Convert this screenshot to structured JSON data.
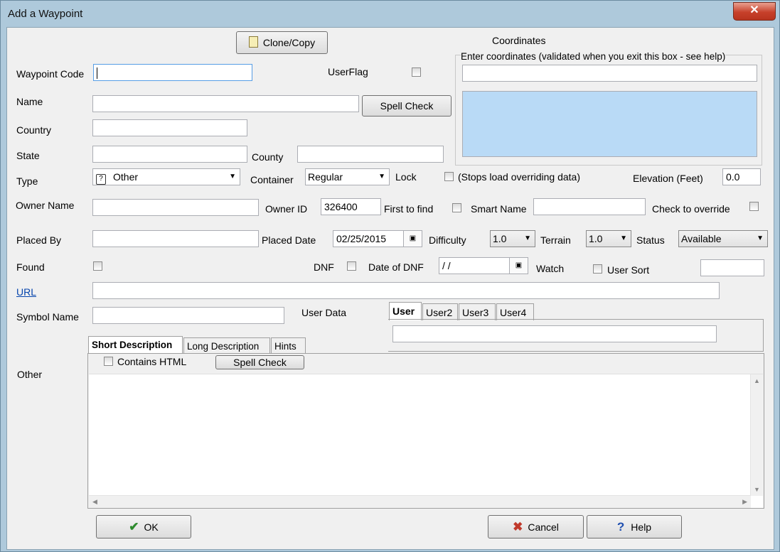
{
  "window": {
    "title": "Add a Waypoint",
    "close_label": "✕"
  },
  "toolbar": {
    "clone_label": "Clone/Copy"
  },
  "coordinates": {
    "title": "Coordinates",
    "group_label": "Enter coordinates (validated when you exit this box - see help)",
    "input_value": "",
    "result_value": ""
  },
  "fields": {
    "waypoint_code": {
      "label": "Waypoint Code",
      "value": ""
    },
    "user_flag": {
      "label": "UserFlag",
      "checked": false
    },
    "name": {
      "label": "Name",
      "value": ""
    },
    "spell_check_label": "Spell Check",
    "country": {
      "label": "Country",
      "value": ""
    },
    "state": {
      "label": "State",
      "value": ""
    },
    "county": {
      "label": "County",
      "value": ""
    },
    "type": {
      "label": "Type",
      "value": "Other"
    },
    "container": {
      "label": "Container",
      "value": "Regular"
    },
    "lock": {
      "label": "Lock",
      "note": "(Stops load overriding data)"
    },
    "elevation": {
      "label": "Elevation (Feet)",
      "value": "0.0"
    },
    "owner_name": {
      "label": "Owner Name",
      "value": ""
    },
    "owner_id": {
      "label": "Owner ID",
      "value": "326400"
    },
    "first_to_find": {
      "label": "First to find"
    },
    "smart_name": {
      "label": "Smart Name",
      "value": ""
    },
    "check_to_override": {
      "label": "Check to override"
    },
    "placed_by": {
      "label": "Placed By",
      "value": ""
    },
    "placed_date": {
      "label": "Placed Date",
      "value": "02/25/2015"
    },
    "difficulty": {
      "label": "Difficulty",
      "value": "1.0"
    },
    "terrain": {
      "label": "Terrain",
      "value": "1.0"
    },
    "status": {
      "label": "Status",
      "value": "Available"
    },
    "found": {
      "label": "Found"
    },
    "dnf": {
      "label": "DNF"
    },
    "date_of_dnf": {
      "label": "Date of DNF",
      "value": " / /"
    },
    "watch": {
      "label": "Watch"
    },
    "user_sort": {
      "label": "User Sort",
      "value": ""
    },
    "url": {
      "label": "URL",
      "value": ""
    },
    "symbol_name": {
      "label": "Symbol Name",
      "value": ""
    },
    "user_data": {
      "label": "User Data"
    },
    "other": {
      "label": "Other"
    }
  },
  "user_tabs": {
    "tabs": [
      {
        "label": "User"
      },
      {
        "label": "User2"
      },
      {
        "label": "User3"
      },
      {
        "label": "User4"
      }
    ],
    "value": ""
  },
  "desc_tabs": {
    "tabs": [
      {
        "label": "Short Description"
      },
      {
        "label": "Long Description"
      },
      {
        "label": "Hints"
      }
    ],
    "contains_html_label": "Contains HTML",
    "spell_check_label": "Spell Check",
    "text": ""
  },
  "footer": {
    "ok_label": "OK",
    "cancel_label": "Cancel",
    "help_label": "Help"
  },
  "colors": {
    "window_frame": "#aec9db",
    "coord_result_bg": "#b9daf6",
    "url_link": "#0645ad",
    "ok_check": "#2e8b2e",
    "cancel_x": "#c0392b",
    "help_q": "#1f4fb0"
  }
}
